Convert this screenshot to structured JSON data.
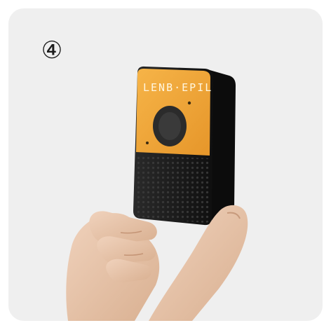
{
  "step": {
    "number": "④"
  },
  "device": {
    "brand_text": "LENB·EPIL",
    "icon": "speaker-device-icon"
  },
  "colors": {
    "card_background": "#efefef",
    "device_body": "#1b1b1b",
    "device_panel": "#f1a435",
    "skin": "#e9c7ae"
  }
}
